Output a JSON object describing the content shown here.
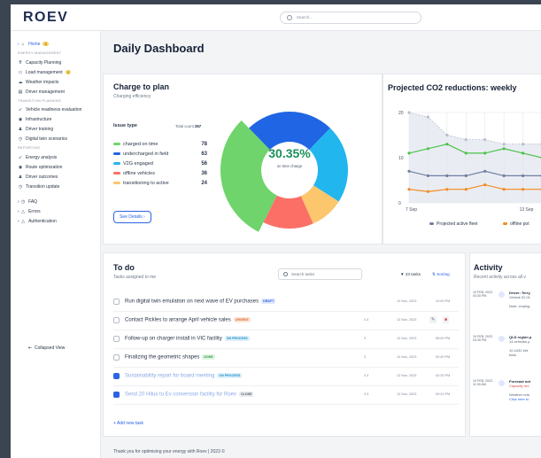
{
  "app": {
    "logo": "ROEV",
    "search_placeholder": "Search..."
  },
  "sidebar": {
    "items": [
      {
        "label": "Home",
        "badge": "3",
        "icon": "home-icon",
        "kind": "home"
      },
      {
        "label": "ENERGY MANAGEMENT",
        "kind": "section"
      },
      {
        "label": "Capacity Planning",
        "icon": "capacity-icon"
      },
      {
        "label": "Load management",
        "badge": "2",
        "icon": "load-icon"
      },
      {
        "label": "Weather impacts",
        "icon": "weather-icon"
      },
      {
        "label": "Driver  management",
        "icon": "driver-icon"
      },
      {
        "label": "TRANSITION PLANNING",
        "kind": "section"
      },
      {
        "label": "Vehicle readiness evaluation",
        "icon": "vehicle-icon"
      },
      {
        "label": "Infrastructure",
        "icon": "infrastructure-icon"
      },
      {
        "label": "Driver training",
        "icon": "training-icon"
      },
      {
        "label": "Digital twin scenarios",
        "icon": "twin-icon"
      },
      {
        "label": "REPORTING",
        "kind": "section"
      },
      {
        "label": "Energy analysis",
        "icon": "energy-icon"
      },
      {
        "label": "Route optimization",
        "icon": "route-icon"
      },
      {
        "label": "Driver outcomes",
        "icon": "outcome-icon"
      },
      {
        "label": "Transition update",
        "icon": "update-icon"
      },
      {
        "label": "FAQ",
        "icon": "faq-icon",
        "expand": true
      },
      {
        "label": "Errors",
        "icon": "errors-icon",
        "expand": true
      },
      {
        "label": "Authentication",
        "icon": "auth-icon",
        "expand": true
      }
    ],
    "collapsed_label": "Collapsed View"
  },
  "page": {
    "title": "Daily Dashboard",
    "footer": "Thank you for optimising your energy with Roev | 2023 ©"
  },
  "charge": {
    "title": "Charge to plan",
    "subtitle": "Charging efficiency",
    "issue_label": "Issue type",
    "total_label": "Total count",
    "total": "257",
    "center_value": "30.35%",
    "center_label": "on time charge",
    "details_button": "See Details",
    "items": [
      {
        "label": "charged on time",
        "value": "78",
        "color": "#6fd46b"
      },
      {
        "label": "undercharged in field",
        "value": "63",
        "color": "#1f65e4"
      },
      {
        "label": "V2G engaged",
        "value": "56",
        "color": "#22b6ef"
      },
      {
        "label": "offline vehicles",
        "value": "36",
        "color": "#fb6f66"
      },
      {
        "label": "transitioning to active",
        "value": "24",
        "color": "#fcc66d"
      }
    ]
  },
  "co2": {
    "title": "Projected CO2 reductions: weekly",
    "legend": [
      "Projected active fleet",
      "offline pot"
    ],
    "legend_colors": [
      "#6f7fa3",
      "#f48a20"
    ]
  },
  "chart_data": {
    "type": "line",
    "title": "Projected CO2 reductions: weekly",
    "x": [
      "7 Sep",
      "",
      "",
      "",
      "",
      "",
      "13 Sep",
      ""
    ],
    "ylim": [
      0,
      20
    ],
    "yticks": [
      "20",
      "10",
      "0"
    ],
    "series": [
      {
        "name": "",
        "color": "#b7bfcc",
        "values": [
          20,
          19,
          15,
          14,
          14,
          13,
          13,
          13
        ]
      },
      {
        "name": "",
        "color": "#4cc24a",
        "values": [
          11,
          12,
          13,
          11,
          11,
          12,
          11,
          10
        ]
      },
      {
        "name": "Projected active fleet",
        "color": "#6f7fa3",
        "values": [
          7,
          6,
          6,
          6,
          7,
          6,
          6,
          6
        ]
      },
      {
        "name": "offline pot",
        "color": "#f48a20",
        "values": [
          3,
          2.5,
          3,
          3,
          4,
          3,
          3,
          3
        ]
      }
    ],
    "grid": true
  },
  "todo": {
    "title": "To do",
    "subtitle": "Tasks assigned to me",
    "search_placeholder": "Search tasks",
    "count": "23 tasks",
    "sort": "Sorting",
    "add": "+ Add new task",
    "tasks": [
      {
        "text": "Run digital twin emulation on next wave of EV purchases",
        "tag": "DRAFT",
        "tagcls": "draft",
        "date": "12 Nov, 2023",
        "time": "12:00 PM",
        "checked": false,
        "meta": ""
      },
      {
        "text": "Contact Pickles to arrange April vehicle sales",
        "tag": "URGENT",
        "tagcls": "urgent",
        "date": "12 Nov, 2023",
        "time": "",
        "checked": false,
        "meta": "4  3"
      },
      {
        "text": "Follow-up on charger install in VIC facility",
        "tag": "ON PROCESS",
        "tagcls": "proc",
        "date": "12 Nov, 2023",
        "time": "08:00 PM",
        "checked": false,
        "meta": "3"
      },
      {
        "text": "Finalizing the geometric shapes",
        "tag": "DONE",
        "tagcls": "done",
        "date": "12 Nov, 2023",
        "time": "02:40 PM",
        "checked": false,
        "meta": "3"
      },
      {
        "text": "Sustainability report for board meeting",
        "tag": "ON PROCESS",
        "tagcls": "proc",
        "date": "12 Nov, 2023",
        "time": "02:30 PM",
        "checked": true,
        "meta": "4  3"
      },
      {
        "text": "Send 20 Hilux to Ev conversion facility for Roev",
        "tag": "CLOSE",
        "tagcls": "close",
        "date": "12 Nov, 2023",
        "time": "09:41 PM",
        "checked": true,
        "meta": "4  3"
      }
    ]
  },
  "activity": {
    "title": "Activity",
    "subtitle": "Recent activity across all v",
    "entries": [
      {
        "date": "19 FEB, 2023",
        "time": "03:30 PM",
        "head": "Driver: Terry",
        "lines": [
          "Vehicle ID-01",
          "",
          "Note: Unplug"
        ]
      },
      {
        "date": "19 FEB, 2023",
        "time": "03:30 PM",
        "head": "QLD region p",
        "lines": [
          "14 vehicles p",
          "",
          "10.4432 kW",
          "total."
        ]
      },
      {
        "date": "19 FEB, 2023",
        "time": "11:30 AM",
        "head": "Forecast not",
        "lines": [
          "Capacity red",
          "",
          "Weather rela",
          "Click here to"
        ]
      }
    ]
  }
}
